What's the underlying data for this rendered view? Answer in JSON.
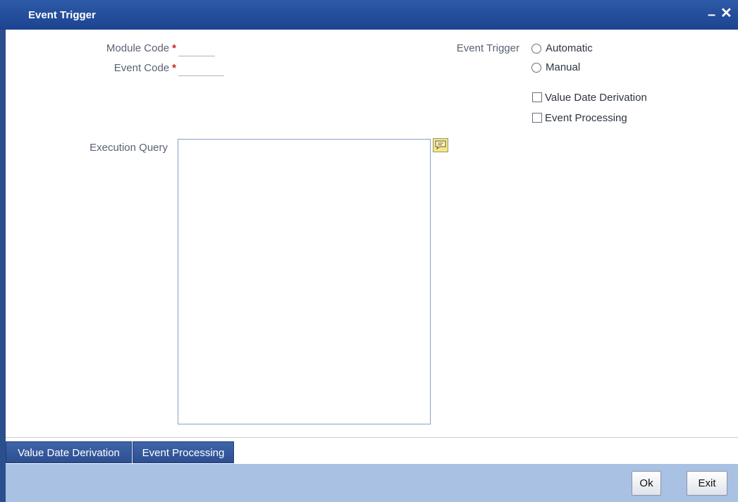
{
  "window": {
    "title": "Event Trigger",
    "minimize_glyph": "–",
    "close_glyph": "✕"
  },
  "form": {
    "module_code": {
      "label": "Module Code",
      "value": "",
      "required_mark": "*"
    },
    "event_code": {
      "label": "Event Code",
      "value": "",
      "required_mark": "*"
    },
    "event_trigger": {
      "label": "Event Trigger",
      "options": [
        "Automatic",
        "Manual"
      ],
      "selected": null
    },
    "checkboxes": [
      {
        "label": "Value Date Derivation",
        "checked": false
      },
      {
        "label": "Event Processing",
        "checked": false
      }
    ],
    "execution_query": {
      "label": "Execution Query",
      "value": ""
    }
  },
  "tabs": [
    {
      "label": "Value Date Derivation"
    },
    {
      "label": "Event Processing"
    }
  ],
  "footer": {
    "ok_label": "Ok",
    "exit_label": "Exit"
  },
  "icons": {
    "comment": "speech-bubble-icon"
  },
  "colors": {
    "titlebar": "#1c4390",
    "required": "#cc2222",
    "footer": "#a9c1e2",
    "tab": "#2d4f92"
  }
}
